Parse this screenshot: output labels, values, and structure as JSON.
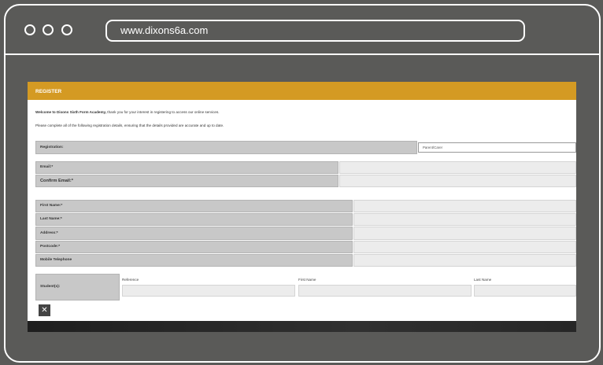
{
  "browser": {
    "url": "www.dixons6a.com"
  },
  "form": {
    "header": "REGISTER",
    "welcome_bold": "Welcome to Dixons Sixth Form Academy,",
    "welcome_rest": " thank you for your interest in registering to access our online services.",
    "instructions": "Please complete all of the following registration details, ensuring that the details provided are accurate and up to date.",
    "registration_label": "Registration:",
    "registration_value": "Parent/Carer",
    "email_label": "Email:*",
    "confirm_email_label": "Confirm Email:*",
    "first_name_label": "First Name:*",
    "last_name_label": "Last Name:*",
    "address_label": "Address:*",
    "postcode_label": "Postcode:*",
    "mobile_label": "Mobile Telephone",
    "students_label": "Student(s):",
    "col_reference": "Reference",
    "col_first_name": "First Name",
    "col_last_name": "Last Name",
    "close_symbol": "✕"
  }
}
